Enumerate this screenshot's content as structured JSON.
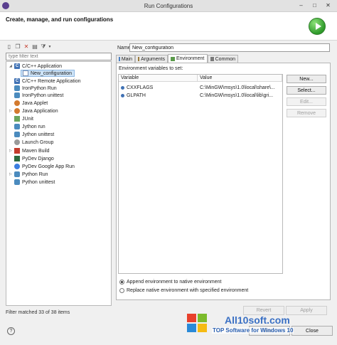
{
  "window": {
    "title": "Run Configurations",
    "minimize": "–",
    "maximize": "□",
    "close": "✕"
  },
  "header": {
    "title": "Create, manage, and run configurations"
  },
  "filter": {
    "placeholder": "type filter text",
    "status": "Filter matched 33 of 38 items"
  },
  "tree": [
    {
      "label": "C/C++ Application",
      "icon": "c-icon",
      "expander": "◢"
    },
    {
      "label": "New_configuration",
      "icon": "config-icon",
      "selected": true
    },
    {
      "label": "C/C++ Remote Application",
      "icon": "c-icon"
    },
    {
      "label": "IronPython Run",
      "icon": "python-icon"
    },
    {
      "label": "IronPython unittest",
      "icon": "python-icon"
    },
    {
      "label": "Java Applet",
      "icon": "java-icon"
    },
    {
      "label": "Java Application",
      "icon": "java-icon",
      "expander": "▷"
    },
    {
      "label": "JUnit",
      "icon": "junit-icon"
    },
    {
      "label": "Jython run",
      "icon": "python-icon"
    },
    {
      "label": "Jython unittest",
      "icon": "python-icon"
    },
    {
      "label": "Launch Group",
      "icon": "launch-icon"
    },
    {
      "label": "Maven Build",
      "icon": "maven-icon",
      "expander": "▷"
    },
    {
      "label": "PyDev Django",
      "icon": "django-icon"
    },
    {
      "label": "PyDev Google App Run",
      "icon": "gae-icon"
    },
    {
      "label": "Python Run",
      "icon": "python-icon",
      "expander": "▷"
    },
    {
      "label": "Python unittest",
      "icon": "python-icon"
    }
  ],
  "name": {
    "label": "Name:",
    "value": "New_configuration"
  },
  "tabs": [
    "Main",
    "Arguments",
    "Environment",
    "Common"
  ],
  "environment": {
    "label": "Environment variables to set:",
    "columns": [
      "Variable",
      "Value"
    ],
    "rows": [
      {
        "variable": "CXXFLAGS",
        "value": "C:\\MinGW\\msys\\1.0\\local\\share\\..."
      },
      {
        "variable": "GLPATH",
        "value": "C:\\MinGW\\msys\\1.0\\local\\lib\\gri..."
      }
    ],
    "buttons": {
      "new": "New...",
      "select": "Select...",
      "edit": "Edit...",
      "remove": "Remove"
    },
    "append_option": "Append environment to native environment",
    "replace_option": "Replace native environment with specified environment"
  },
  "actions": {
    "revert": "Revert",
    "apply": "Apply",
    "run": "Run",
    "close": "Close"
  },
  "watermark": {
    "text1": "All10soft.com",
    "text2": "TOP Software for Windows 10"
  },
  "colors": {
    "accent": "#3a70c4",
    "selection": "#cde3f7",
    "run_green": "#2e9a2a"
  }
}
